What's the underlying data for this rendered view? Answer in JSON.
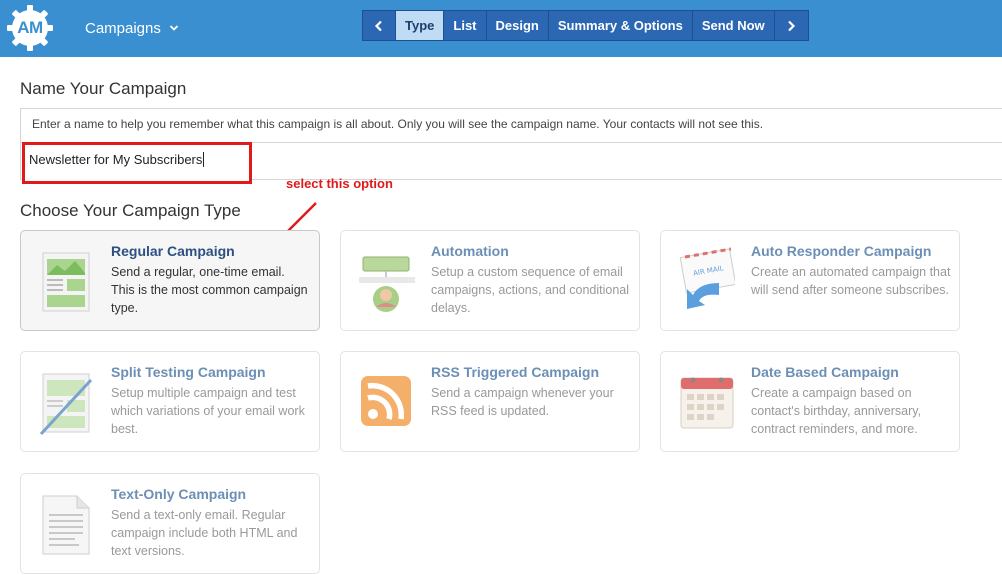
{
  "header": {
    "logo_text": "AM",
    "menu_label": "Campaigns",
    "steps": [
      {
        "label": "Type",
        "active": true
      },
      {
        "label": "List"
      },
      {
        "label": "Design"
      },
      {
        "label": "Summary & Options"
      },
      {
        "label": "Send Now"
      }
    ]
  },
  "name_section": {
    "heading": "Name Your Campaign",
    "hint": "Enter a name to help you remember what this campaign is all about. Only you will see the campaign name. Your contacts will not see this.",
    "input_value": "Newsletter for My Subscribers"
  },
  "annotation": {
    "text": "select this option",
    "color": "#e01a1a"
  },
  "type_section": {
    "heading": "Choose Your Campaign Type",
    "cards": [
      {
        "title": "Regular Campaign",
        "desc": "Send a regular, one-time email. This is the most common campaign type.",
        "icon": "regular-campaign-icon",
        "selected": true
      },
      {
        "title": "Automation",
        "desc": "Setup a custom sequence of email campaigns, actions, and conditional delays.",
        "icon": "automation-icon"
      },
      {
        "title": "Auto Responder Campaign",
        "desc": "Create an automated campaign that will send after someone subscribes.",
        "icon": "auto-responder-icon"
      },
      {
        "title": "Split Testing Campaign",
        "desc": "Setup multiple campaign and test which variations of your email work best.",
        "icon": "split-testing-icon"
      },
      {
        "title": "RSS Triggered Campaign",
        "desc": "Send a campaign whenever your RSS feed is updated.",
        "icon": "rss-icon"
      },
      {
        "title": "Date Based Campaign",
        "desc": "Create a campaign based on contact's birthday, anniversary, contract reminders, and more.",
        "icon": "calendar-icon"
      },
      {
        "title": "Text-Only Campaign",
        "desc": "Send a text-only email. Regular campaign include both HTML and text versions.",
        "icon": "text-document-icon"
      }
    ]
  },
  "colors": {
    "header_bg": "#3a8fd0",
    "stepper_bg": "#2b67b2",
    "stepper_active": "#bfdcf4",
    "highlight_red": "#e01a1a",
    "card_title": "#6c8fb5"
  }
}
